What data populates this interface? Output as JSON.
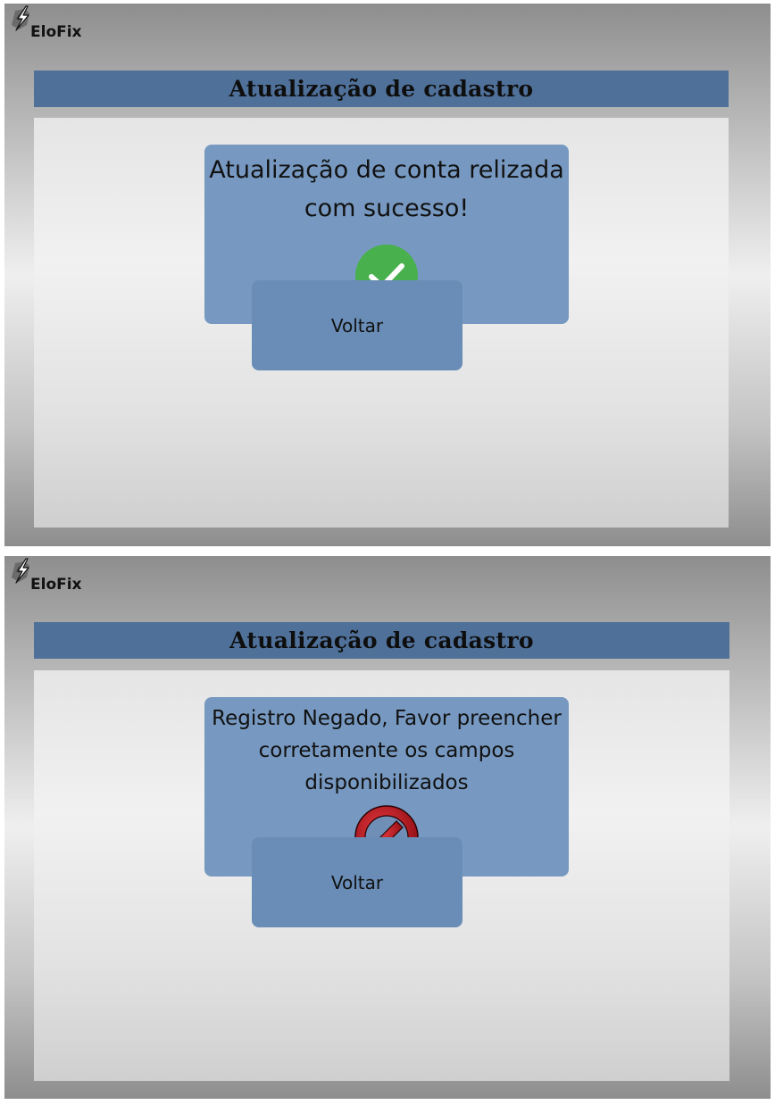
{
  "screens": [
    {
      "app_name": "EloFix",
      "title": "Atualização de cadastro",
      "message": "Atualização de conta relizada com sucesso!",
      "status_icon": "check-circle-icon",
      "status_color": "#48b04c",
      "button_label": "Voltar"
    },
    {
      "app_name": "EloFix",
      "title": "Atualização de cadastro",
      "message": "Registro Negado, Favor preencher corretamente os campos disponibilizados",
      "status_icon": "prohibited-icon",
      "status_color": "#b3121b",
      "button_label": "Voltar"
    }
  ],
  "colors": {
    "title_bar": "#4f7099",
    "message_box": "#7799c1",
    "button": "#6a8db7"
  }
}
